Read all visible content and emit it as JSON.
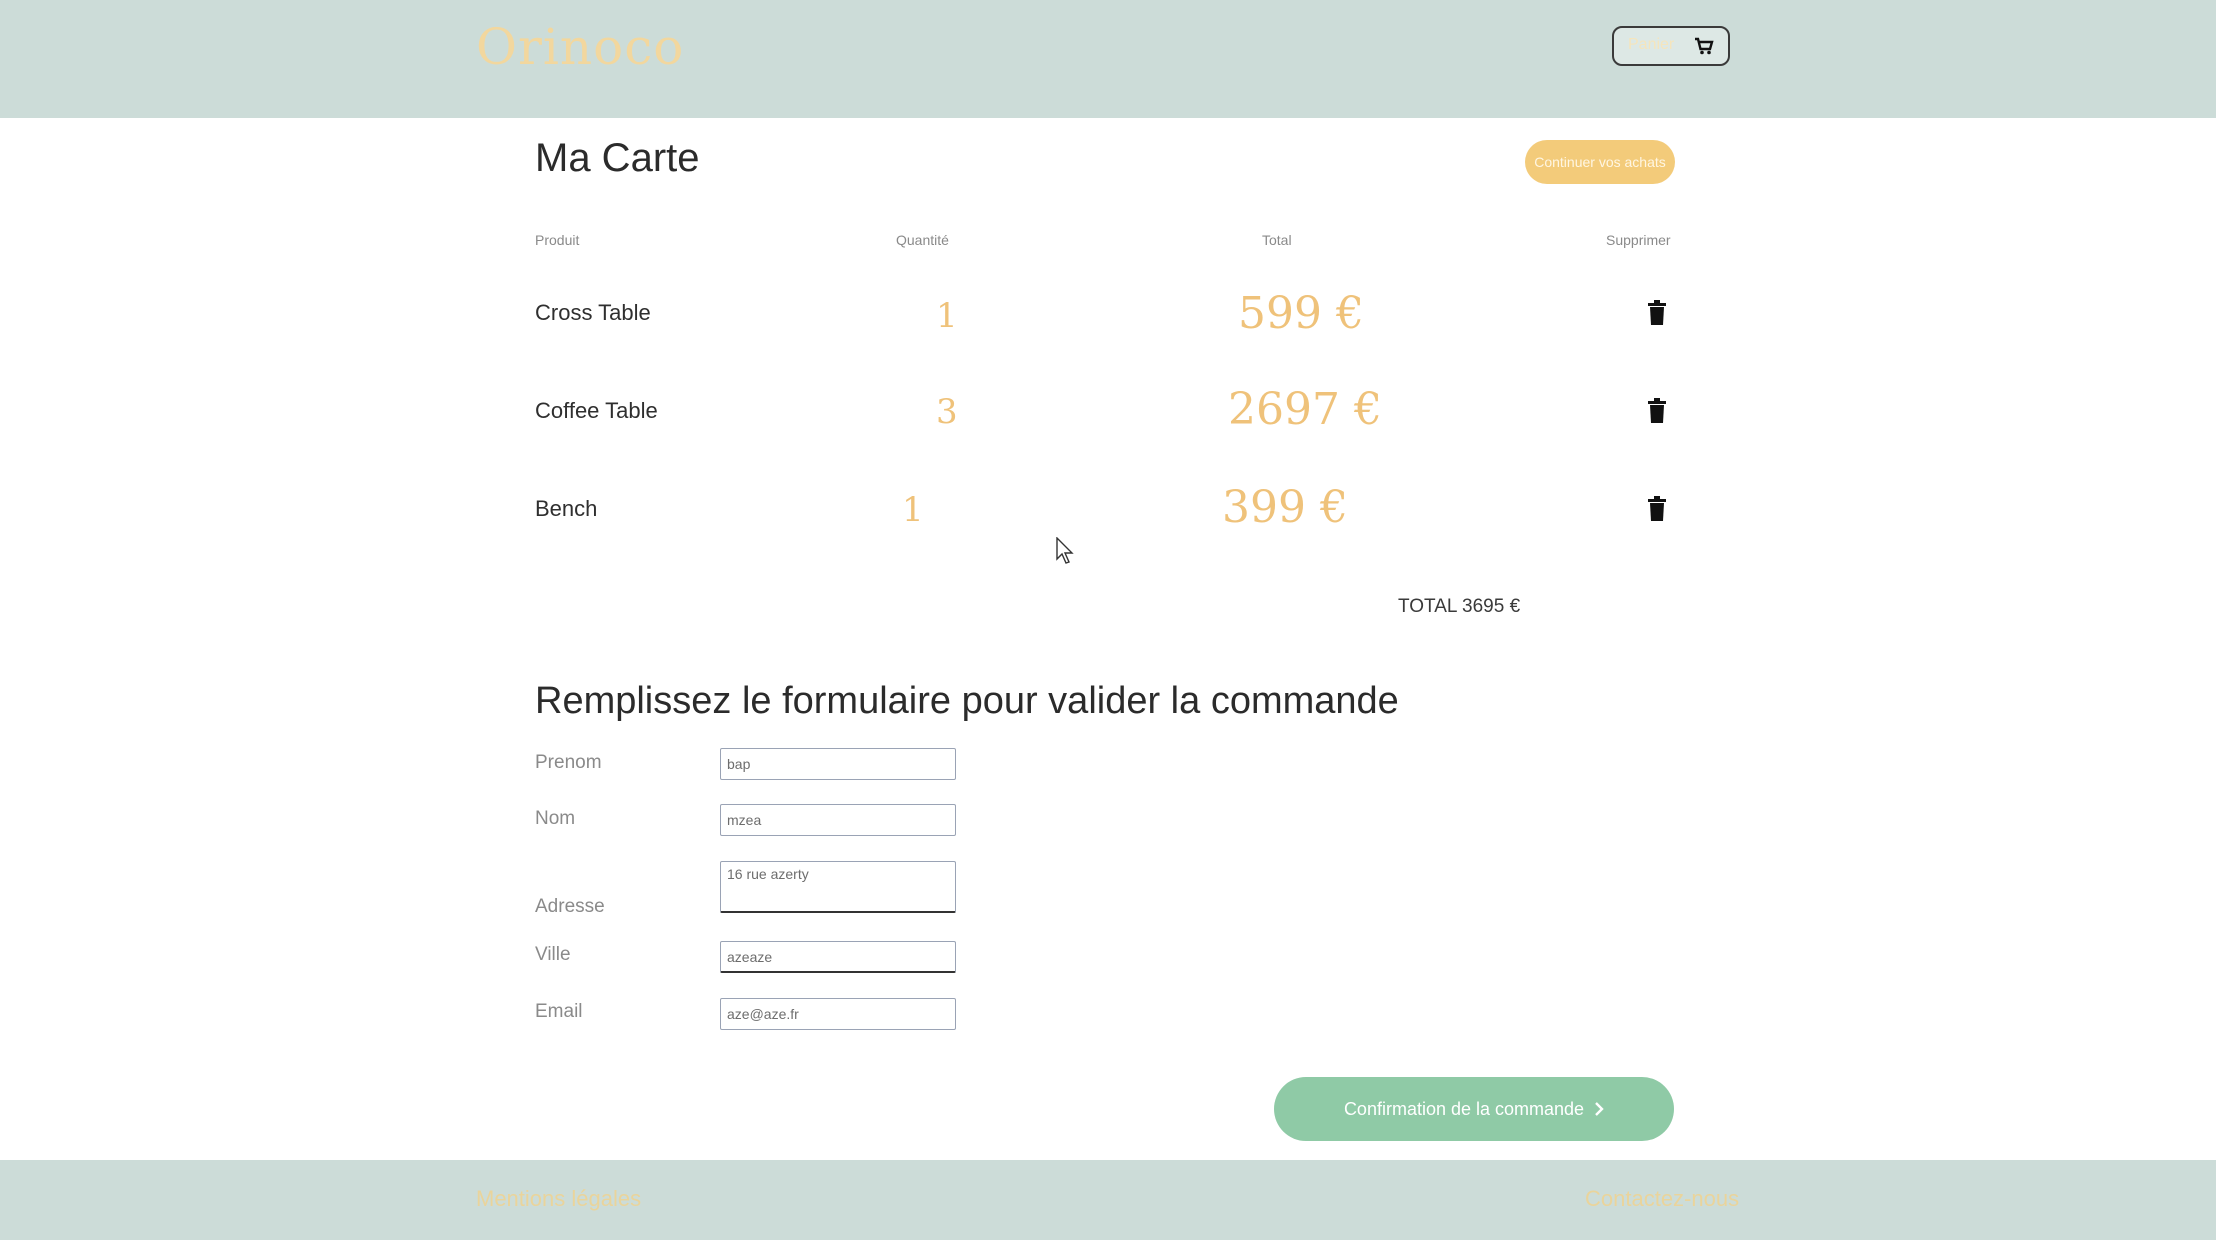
{
  "header": {
    "logo": "Orinoco",
    "cart_label": "Panier"
  },
  "main": {
    "title": "Ma Carte",
    "continue_label": "Continuer vos achats",
    "columns": [
      "Produit",
      "Quantité",
      "Total",
      "Supprimer"
    ],
    "rows": [
      {
        "name": "Cross Table",
        "qty": "1",
        "total": "599 €"
      },
      {
        "name": "Coffee Table",
        "qty": "3",
        "total": "2697 €"
      },
      {
        "name": "Bench",
        "qty": "1",
        "total": "399 €"
      }
    ],
    "grand_total": "TOTAL 3695 €"
  },
  "form": {
    "title": "Remplissez le formulaire pour valider la commande",
    "prenom_label": "Prenom",
    "prenom_value": "bap",
    "nom_label": "Nom",
    "nom_value": "mzea",
    "adresse_label": "Adresse",
    "adresse_value": "16 rue azerty",
    "ville_label": "Ville",
    "ville_value": "azeaze",
    "email_label": "Email",
    "email_value": "aze@aze.fr",
    "confirm_label": "Confirmation de la commande"
  },
  "footer": {
    "left": "Mentions légales",
    "right": "Contactez-nous"
  },
  "colors": {
    "header_bg": "#ccdcd8",
    "accent_gold": "#efc27a",
    "confirm_green": "#8fcaa6"
  }
}
